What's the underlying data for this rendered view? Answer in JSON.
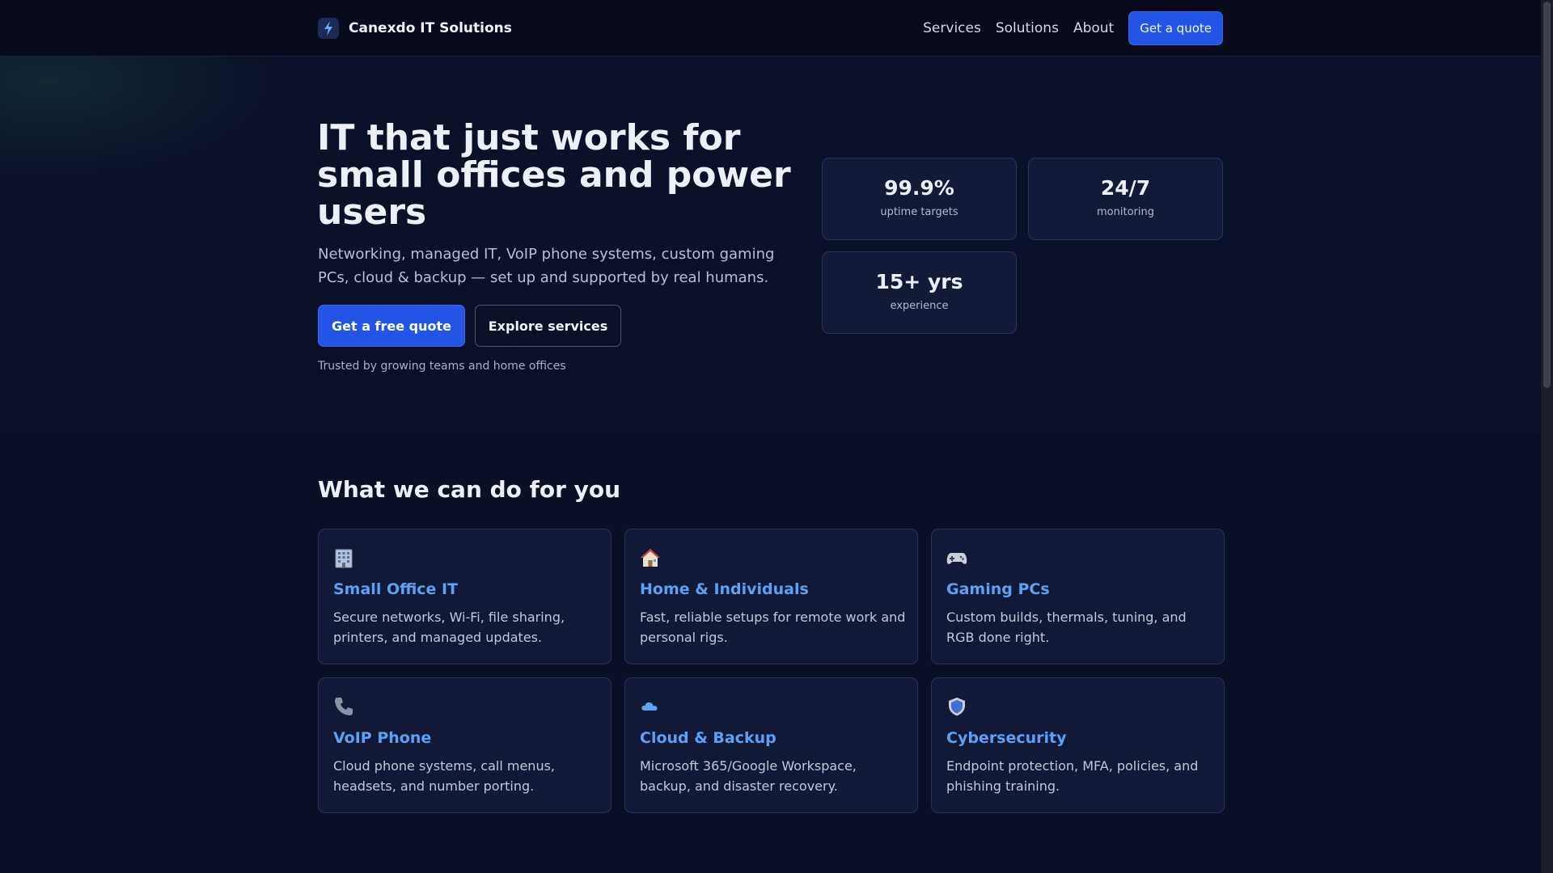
{
  "header": {
    "brand_name": "Canexdo IT Solutions",
    "nav": [
      "Services",
      "Solutions",
      "About"
    ],
    "cta": "Get a quote"
  },
  "hero": {
    "title": "IT that just works for small offices and power users",
    "subtitle": "Networking, managed IT, VoIP phone systems, custom gaming PCs, cloud & backup — set up and supported by real humans.",
    "primary_button": "Get a free quote",
    "secondary_button": "Explore services",
    "trust_text": "Trusted by growing teams and home offices"
  },
  "stats": [
    {
      "value": "99.9%",
      "label": "uptime targets"
    },
    {
      "value": "24/7",
      "label": "monitoring"
    },
    {
      "value": "15+ yrs",
      "label": "experience"
    }
  ],
  "services": {
    "title": "What we can do for you",
    "cards": [
      {
        "icon": "office-building-icon",
        "title": "Small Office IT",
        "desc": "Secure networks, Wi-Fi, file sharing, printers, and managed updates."
      },
      {
        "icon": "house-icon",
        "title": "Home & Individuals",
        "desc": "Fast, reliable setups for remote work and personal rigs."
      },
      {
        "icon": "gamepad-icon",
        "title": "Gaming PCs",
        "desc": "Custom builds, thermals, tuning, and RGB done right."
      },
      {
        "icon": "phone-icon",
        "title": "VoIP Phone",
        "desc": "Cloud phone systems, call menus, headsets, and number porting."
      },
      {
        "icon": "cloud-icon",
        "title": "Cloud & Backup",
        "desc": "Microsoft 365/Google Workspace, backup, and disaster recovery."
      },
      {
        "icon": "shield-icon",
        "title": "Cybersecurity",
        "desc": "Endpoint protection, MFA, policies, and phishing training."
      }
    ]
  },
  "colors": {
    "accent": "#2354e6",
    "card_title": "#5aa2f5",
    "background": "#0b1026"
  }
}
